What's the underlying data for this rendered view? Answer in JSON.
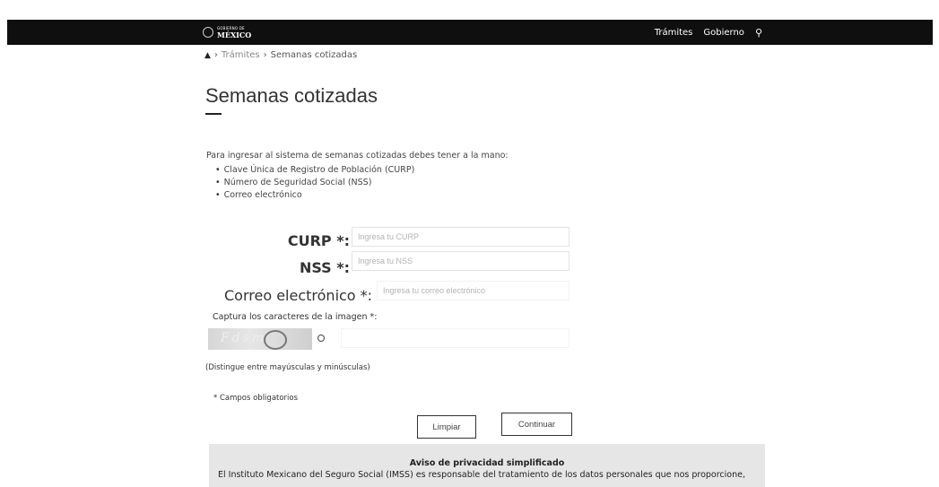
{
  "header": {
    "logo_small": "GOBIERNO DE",
    "logo_big": "MÉXICO",
    "nav": [
      "Trámites",
      "Gobierno"
    ]
  },
  "breadcrumb": {
    "home_icon": "home-icon",
    "items": [
      "Trámites",
      "Semanas cotizadas"
    ],
    "separator": "›"
  },
  "page": {
    "title": "Semanas cotizadas",
    "intro": "Para ingresar al sistema de semanas cotizadas debes tener a la mano:",
    "requirements": [
      "Clave Única de Registro de Población (CURP)",
      "Número de Seguridad Social (NSS)",
      "Correo electrónico"
    ]
  },
  "form": {
    "curp": {
      "label": "CURP *:",
      "placeholder": "Ingresa tu CURP",
      "value": ""
    },
    "nss": {
      "label": "NSS *:",
      "placeholder": "Ingresa tu NSS",
      "value": ""
    },
    "email": {
      "label": "Correo electrónico *:",
      "placeholder": "Ingresa tu correo electrónico",
      "value": ""
    },
    "captcha_label": "Captura los caracteres de la imagen *:",
    "case_note": "(Distingue entre mayúsculas y minúsculas)",
    "required_note": "* Campos obligatorios",
    "clear_label": "Limpiar",
    "continue_label": "Continuar"
  },
  "privacy": {
    "title": "Aviso de privacidad simplificado",
    "text": "El Instituto Mexicano del Seguro Social (IMSS) es responsable del tratamiento de los datos personales que nos proporcione,"
  },
  "colors": {
    "topbar": "#0f0f0f",
    "privacy_bg": "#e6e6e6"
  }
}
